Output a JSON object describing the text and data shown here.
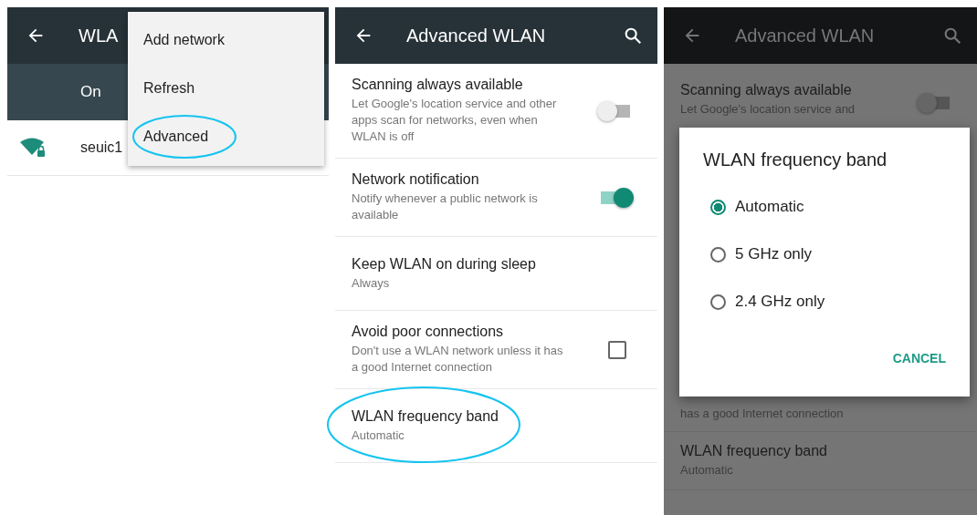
{
  "wlan_screen": {
    "title": "WLA",
    "status_label": "On",
    "networks": [
      {
        "name": "seuic1"
      }
    ],
    "overflow_menu": {
      "items": [
        {
          "label": "Add network",
          "highlighted": false
        },
        {
          "label": "Refresh",
          "highlighted": false
        },
        {
          "label": "Advanced",
          "highlighted": true
        }
      ]
    }
  },
  "advanced_screen": {
    "title": "Advanced WLAN",
    "settings": [
      {
        "kind": "switch",
        "title": "Scanning always available",
        "summary": "Let Google's location service and other apps scan for networks, even when WLAN is off",
        "on": false,
        "highlighted": false
      },
      {
        "kind": "switch",
        "title": "Network notification",
        "summary": "Notify whenever a public network is available",
        "on": true,
        "highlighted": false
      },
      {
        "kind": "plain",
        "title": "Keep WLAN on during sleep",
        "summary": "Always",
        "highlighted": false
      },
      {
        "kind": "checkbox",
        "title": "Avoid poor connections",
        "summary": "Don't use a WLAN network unless it has a good Internet connection",
        "checked": false,
        "highlighted": false
      },
      {
        "kind": "plain",
        "title": "WLAN frequency band",
        "summary": "Automatic",
        "highlighted": true
      }
    ]
  },
  "dialog_screen": {
    "title": "Advanced WLAN",
    "background_settings": [
      {
        "kind": "switch",
        "title": "Scanning always available",
        "summary": "Let Google's location service and",
        "on": false
      },
      {
        "kind": "fragment",
        "summary": "has a good Internet connection"
      },
      {
        "kind": "plain",
        "title": "WLAN frequency band",
        "summary": "Automatic"
      }
    ],
    "dialog": {
      "title": "WLAN frequency band",
      "options": [
        {
          "label": "Automatic",
          "selected": true
        },
        {
          "label": "5 GHz only",
          "selected": false
        },
        {
          "label": "2.4 GHz only",
          "selected": false
        }
      ],
      "cancel": "CANCEL"
    }
  }
}
